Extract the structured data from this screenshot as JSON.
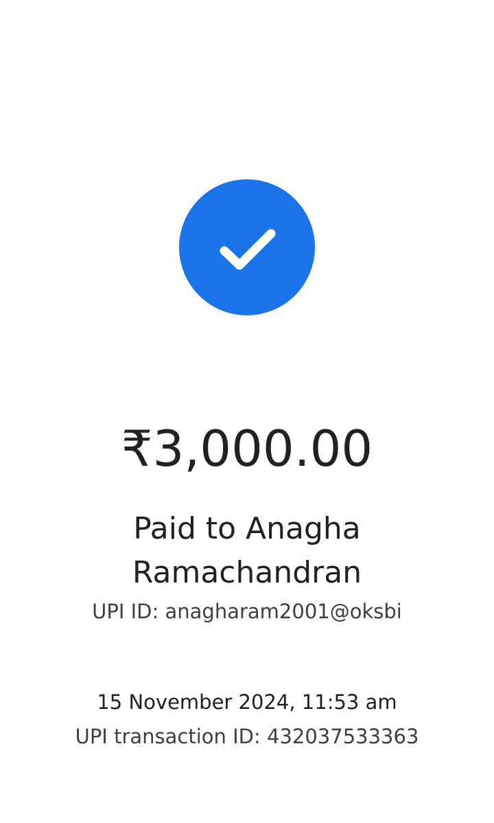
{
  "status": {
    "icon": "checkmark-icon",
    "circle_color": "#1a73e8"
  },
  "payment": {
    "amount": "₹3,000.00",
    "paid_to": "Paid to Anagha Ramachandran",
    "upi_id": "UPI ID: anagharam2001@oksbi",
    "timestamp": "15 November 2024, 11:53 am",
    "transaction_id": "UPI transaction ID: 432037533363"
  }
}
